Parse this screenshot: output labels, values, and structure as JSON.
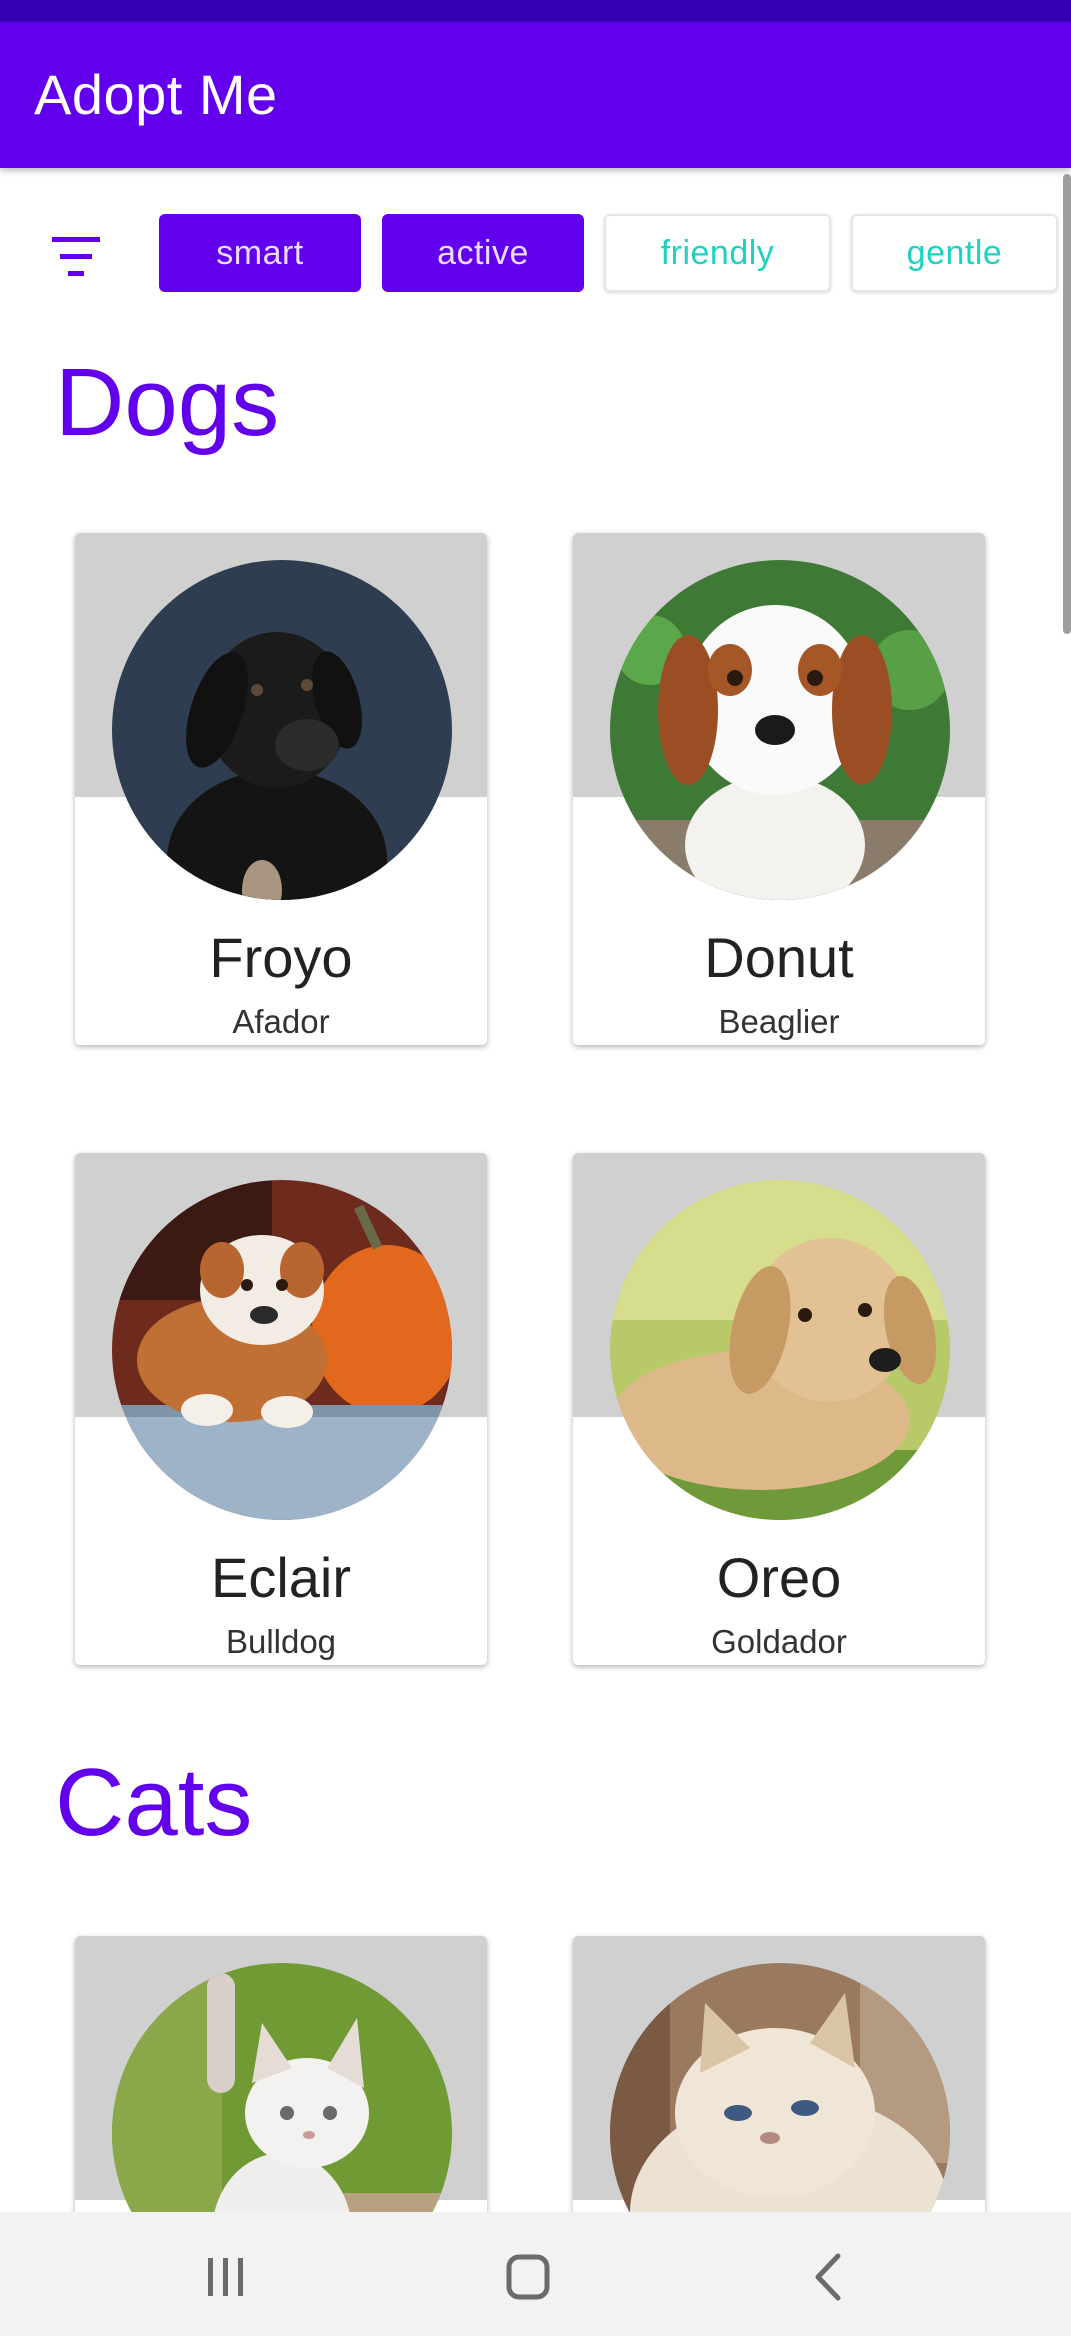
{
  "app": {
    "title": "Adopt Me"
  },
  "filters": {
    "chips": [
      {
        "label": "smart",
        "selected": true
      },
      {
        "label": "active",
        "selected": true
      },
      {
        "label": "friendly",
        "selected": false
      },
      {
        "label": "gentle",
        "selected": false
      }
    ]
  },
  "sections": [
    {
      "title": "Dogs",
      "pets": [
        {
          "name": "Froyo",
          "breed": "Afador",
          "photo": "black-dog-photo"
        },
        {
          "name": "Donut",
          "breed": "Beaglier",
          "photo": "spaniel-puppy-photo"
        },
        {
          "name": "Eclair",
          "breed": "Bulldog",
          "photo": "bulldog-puppy-photo"
        },
        {
          "name": "Oreo",
          "breed": "Goldador",
          "photo": "golden-puppy-photo"
        }
      ]
    },
    {
      "title": "Cats",
      "pets": [
        {
          "photo": "white-kitten-photo"
        },
        {
          "photo": "persian-cat-photo"
        }
      ]
    }
  ],
  "colors": {
    "primary": "#6200ee",
    "primary_dark": "#3700b3",
    "chip_unselected_text": "#1ed2c0"
  },
  "nav": {
    "buttons": [
      "recent-apps-icon",
      "home-icon",
      "back-icon"
    ]
  }
}
